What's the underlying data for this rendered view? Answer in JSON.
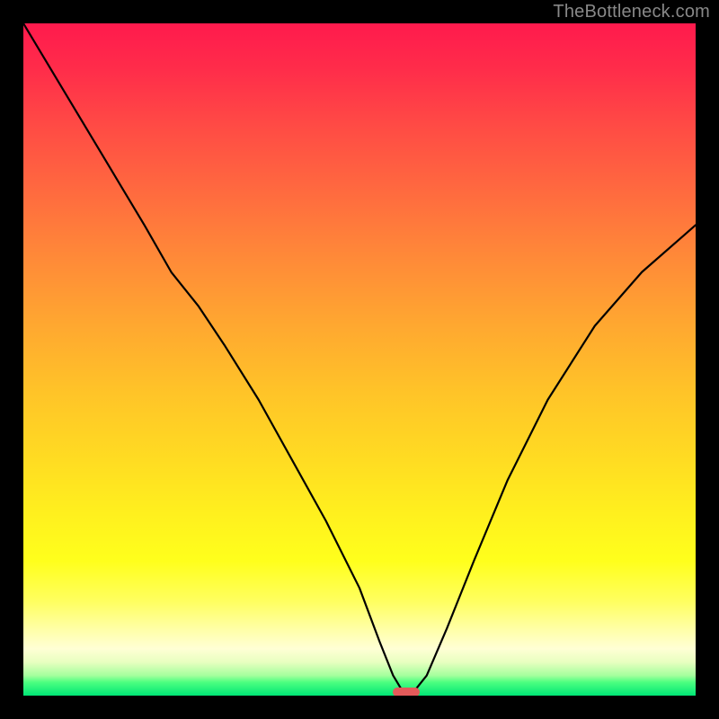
{
  "watermark": "TheBottleneck.com",
  "colors": {
    "frame": "#000000",
    "curve": "#000000",
    "marker": "#e35a5a"
  },
  "chart_data": {
    "type": "line",
    "title": "",
    "xlabel": "",
    "ylabel": "",
    "xlim": [
      0,
      100
    ],
    "ylim": [
      0,
      100
    ],
    "grid": false,
    "legend": false,
    "x": [
      0,
      6,
      12,
      18,
      22,
      26,
      30,
      35,
      40,
      45,
      50,
      53,
      55,
      56.5,
      58,
      60,
      63,
      67,
      72,
      78,
      85,
      92,
      100
    ],
    "values": [
      100,
      90,
      80,
      70,
      63,
      58,
      52,
      44,
      35,
      26,
      16,
      8,
      3,
      0.5,
      0.5,
      3,
      10,
      20,
      32,
      44,
      55,
      63,
      70
    ],
    "marker": {
      "x": 57,
      "y": 0.5,
      "width": 4,
      "height": 1.3
    }
  }
}
